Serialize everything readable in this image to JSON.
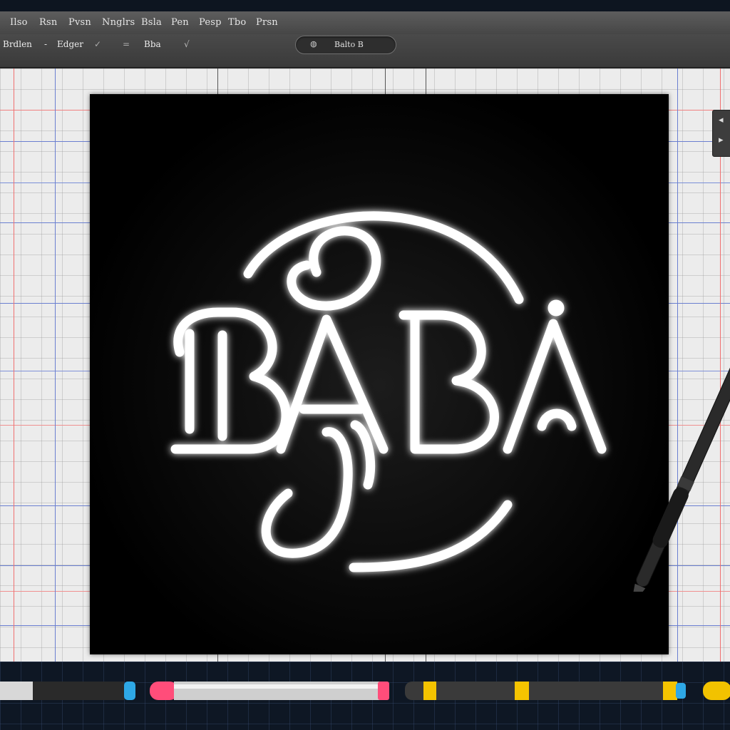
{
  "menubar": {
    "items": [
      "Ilso",
      "Rsn",
      "Pvsn",
      "Nnglrs",
      "Bsla",
      "Pen",
      "Pesp",
      "Tbo",
      "Prsn"
    ]
  },
  "options_bar": {
    "brush_label": "Brdlen",
    "dash": "-",
    "edger_label": "Edger",
    "check_mark": "✓",
    "separator": "=",
    "preset_label": "Bba",
    "preset_chevron": "√"
  },
  "document_tab": {
    "icon": "document-status-icon",
    "label": "Balto B"
  },
  "canvas": {
    "logo_text": "BABA",
    "background": "#000000",
    "stroke_color": "#ffffff"
  },
  "side_panel": {
    "icons": [
      "collapse-arrow-icon",
      "play-arrow-icon"
    ]
  },
  "tools": {
    "pen": "stylus-pen-icon",
    "markers": [
      {
        "name": "silver-black-marker",
        "cap": "#2ea8e6"
      },
      {
        "name": "pink-silver-marker",
        "cap": "#ff4d7a"
      },
      {
        "name": "black-yellow-marker",
        "cap": "#f5c400"
      },
      {
        "name": "yellow-marker",
        "cap": "#f2c200"
      }
    ]
  },
  "colors": {
    "guide_red": "#f06a6a",
    "guide_blue": "#5b6fc9"
  }
}
